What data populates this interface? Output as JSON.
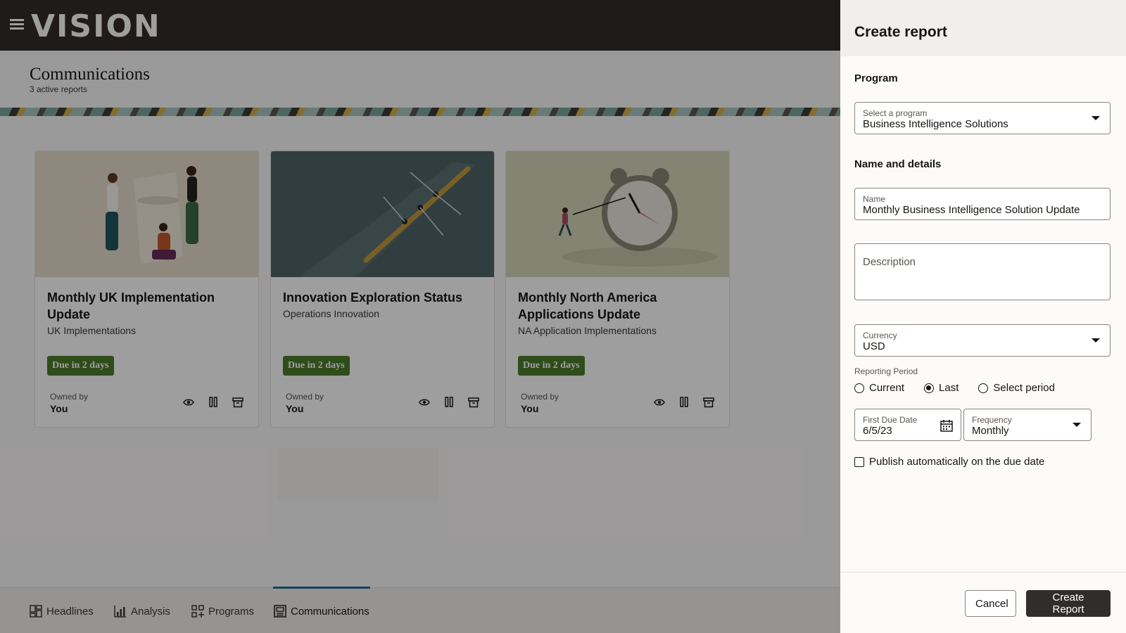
{
  "header": {
    "logo": "VISION"
  },
  "page": {
    "title": "Communications",
    "subtitle": "3 active reports"
  },
  "cards": [
    {
      "title": "Monthly UK Implementation Update",
      "program": "UK Implementations",
      "due": "Due in 2 days",
      "owned_label": "Owned by",
      "owner": "You"
    },
    {
      "title": "Innovation Exploration Status",
      "program": "Operations Innovation",
      "due": "Due in 2 days",
      "owned_label": "Owned by",
      "owner": "You"
    },
    {
      "title": "Monthly North America Applications Update",
      "program": "NA Application Implementations",
      "due": "Due in 2 days",
      "owned_label": "Owned by",
      "owner": "You"
    }
  ],
  "tabs": [
    {
      "label": "Headlines",
      "icon": "dashboard-icon"
    },
    {
      "label": "Analysis",
      "icon": "bar-chart-icon"
    },
    {
      "label": "Programs",
      "icon": "grid-plus-icon"
    },
    {
      "label": "Communications",
      "icon": "newspaper-icon",
      "active": true
    }
  ],
  "drawer": {
    "title": "Create report",
    "program_section": "Program",
    "program_label": "Select a program",
    "program_value": "Business Intelligence Solutions",
    "details_section": "Name and details",
    "name_label": "Name",
    "name_value": "Monthly Business Intelligence Solution Update",
    "description_placeholder": "Description",
    "currency_label": "Currency",
    "currency_value": "USD",
    "reporting_period_label": "Reporting Period",
    "reporting_period_options": [
      "Current",
      "Last",
      "Select period"
    ],
    "reporting_period_selected": "Last",
    "first_due_label": "First Due Date",
    "first_due_value": "6/5/23",
    "frequency_label": "Frequency",
    "frequency_value": "Monthly",
    "publish_label": "Publish automatically on the due date",
    "publish_checked": false,
    "cancel_label": "Cancel",
    "create_label": "Create Report"
  },
  "colors": {
    "header_bg": "#312d2a",
    "badge_green": "#4b7d2b",
    "primary_button": "#312d2a"
  }
}
